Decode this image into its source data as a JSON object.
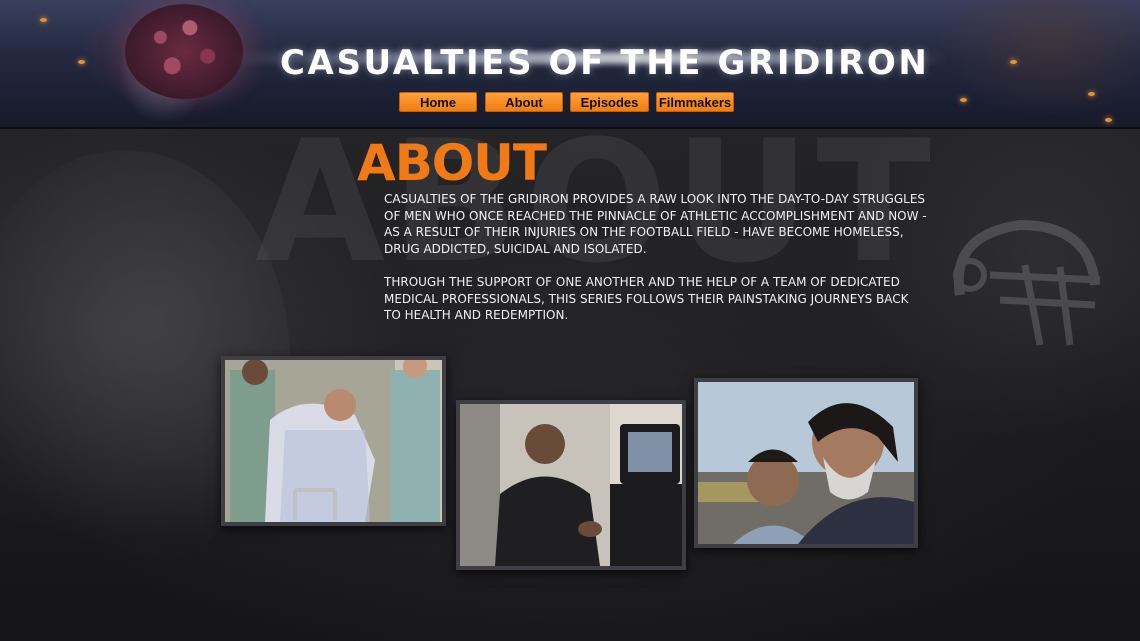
{
  "site": {
    "title": "CASUALTIES OF THE GRIDIRON"
  },
  "nav": {
    "items": [
      {
        "label": "Home"
      },
      {
        "label": "About"
      },
      {
        "label": "Episodes"
      },
      {
        "label": "Filmmakers"
      }
    ]
  },
  "page": {
    "heading": "ABOUT",
    "background_word": "ABOUT",
    "paragraphs": [
      "CASUALTIES OF THE GRIDIRON PROVIDES A RAW LOOK INTO THE DAY-TO-DAY STRUGGLES OF MEN WHO ONCE REACHED THE PINNACLE OF ATHLETIC ACCOMPLISHMENT AND NOW - AS A RESULT OF THEIR INJURIES ON THE FOOTBALL FIELD - HAVE BECOME HOMELESS, DRUG ADDICTED, SUICIDAL AND ISOLATED.",
      "THROUGH THE SUPPORT OF ONE ANOTHER AND THE HELP OF A TEAM OF DEDICATED MEDICAL PROFESSIONALS, THIS SERIES FOLLOWS THEIR PAINSTAKING JOURNEYS BACK TO HEALTH AND REDEMPTION."
    ]
  },
  "colors": {
    "accent": "#f27a16",
    "button": "#f58a20",
    "background": "#1d1d1f",
    "text": "#f2f2f2"
  }
}
